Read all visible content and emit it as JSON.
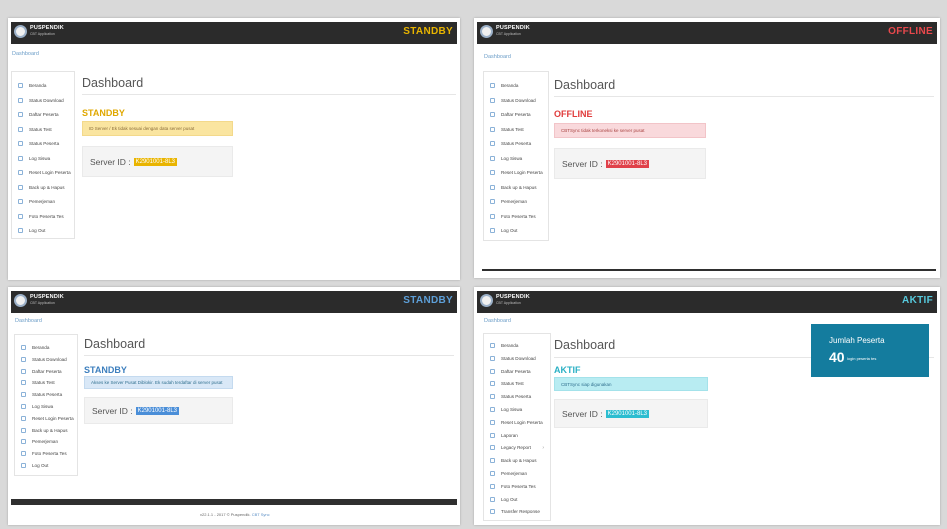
{
  "panels": [
    {
      "brand": "PUSPENDIK",
      "brand_sub": "CBT Application",
      "status": "STANDBY",
      "status_color": "#e8b400",
      "breadcrumb": "Dashboard",
      "title": "Dashboard",
      "state": "STANDBY",
      "state_color": "#e0a800",
      "alert": {
        "text": "ID Server / Ek tidak sesuai dengan data server pusat",
        "bg": "#fae5a0",
        "fg": "#8a6d3b",
        "border": "#f3d98b"
      },
      "server_label": "Server ID :",
      "server_id": "K2901001-8L3",
      "server_id_bg": "#e9b400",
      "menu": [
        "Beranda",
        "Status Download",
        "Daftar Peserta",
        "Status Test",
        "Status Peserta",
        "Log Siswa",
        "Reset Login Peserta",
        "Back up & Hapus",
        "Pemerjeman",
        "Foto Peserta Tes",
        "Log Out"
      ]
    },
    {
      "brand": "PUSPENDIK",
      "brand_sub": "CBT Application",
      "status": "OFFLINE",
      "status_color": "#e8484c",
      "breadcrumb": "Dashboard",
      "title": "Dashboard",
      "state": "OFFLINE",
      "state_color": "#e03b3b",
      "alert": {
        "text": "CBTSync tidak terkoneksi ke server pusat",
        "bg": "#f9d9dc",
        "fg": "#a94442",
        "border": "#f2c4c8"
      },
      "server_label": "Server ID :",
      "server_id": "K2901001-8L3",
      "server_id_bg": "#e0414a",
      "menu": [
        "Beranda",
        "Status Download",
        "Daftar Peserta",
        "Status Test",
        "Status Peserta",
        "Log Siswa",
        "Reset Login Peserta",
        "Back up & Hapus",
        "Pemerjeman",
        "Foto Peserta Tes",
        "Log Out"
      ]
    },
    {
      "brand": "PUSPENDIK",
      "brand_sub": "CBT Application",
      "status": "STANDBY",
      "status_color": "#5d9fd8",
      "breadcrumb": "Dashboard",
      "title": "Dashboard",
      "state": "STANDBY",
      "state_color": "#3d7fbe",
      "alert": {
        "text": "Akses ke Server Pusat Diblokir. Ek sudah terdaftar di server pusat",
        "bg": "#d9e8f7",
        "fg": "#31708f",
        "border": "#c4daef"
      },
      "server_label": "Server ID :",
      "server_id": "K2901001-8L3",
      "server_id_bg": "#4a8ed8",
      "menu": [
        "Beranda",
        "Status Download",
        "Daftar Peserta",
        "Status Test",
        "Status Peserta",
        "Log Siswa",
        "Reset Login Peserta",
        "Back up & Hapus",
        "Pemerjeman",
        "Foto Peserta Tes",
        "Log Out"
      ],
      "footer": {
        "version": "v22.1.1",
        "copyright": "- 2017 © Puspendik.",
        "link": "CBT Sync"
      }
    },
    {
      "brand": "PUSPENDIK",
      "brand_sub": "CBT Application",
      "status": "AKTIF",
      "status_color": "#56c9dc",
      "breadcrumb": "Dashboard",
      "title": "Dashboard",
      "state": "AKTIF",
      "state_color": "#2ab0c4",
      "alert": {
        "text": "CBTSync siap digunakan",
        "bg": "#b8ecf2",
        "fg": "#31708f",
        "border": "#a4e2ea"
      },
      "server_label": "Server ID :",
      "server_id": "K2901001-8L3",
      "server_id_bg": "#2cbdd0",
      "menu": [
        "Beranda",
        "Status Download",
        "Daftar Peserta",
        "Status Test",
        "Status Peserta",
        "Log Siswa",
        "Reset Login Peserta",
        "Laporan",
        "Legacy Report",
        "Back up & Hapus",
        "Pemerjeman",
        "Foto Peserta Tes",
        "Log Out",
        "Transfer Response"
      ],
      "stat": {
        "label": "Jumlah Peserta",
        "number": "40",
        "text": "login peserta tes"
      }
    }
  ]
}
